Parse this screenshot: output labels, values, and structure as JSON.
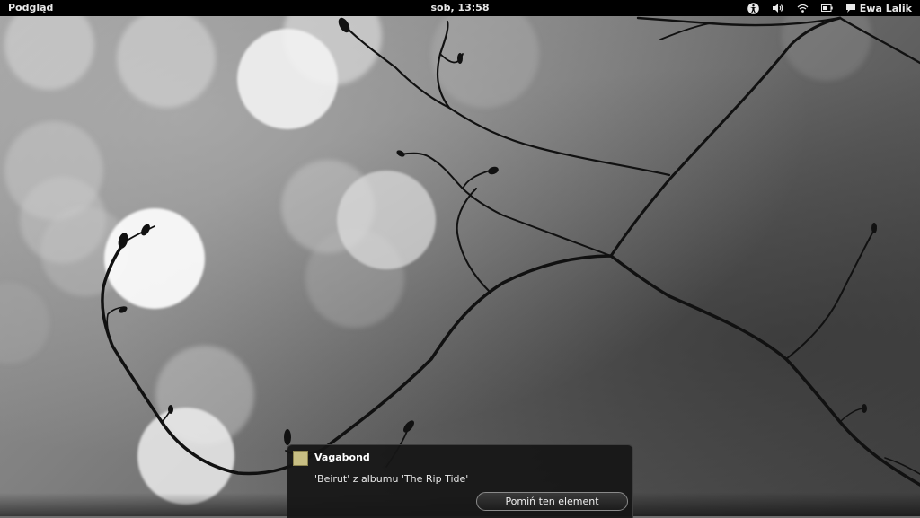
{
  "top_bar": {
    "activities_label": "Podgląd",
    "clock": "sob, 13:58",
    "tray_icons": [
      "accessibility-icon",
      "volume-icon",
      "wifi-icon",
      "battery-icon"
    ],
    "user_icon": "chat-bubble-icon",
    "user_name": "Ewa Lalik"
  },
  "notification": {
    "icon": "album-cover-icon",
    "title": "Vagabond",
    "body": "'Beirut' z albumu 'The Rip Tide'",
    "action_label": "Pomiń ten element"
  },
  "colors": {
    "top_bar_bg": "#000000",
    "notification_bg": "#161616",
    "album_icon": "#c8bf84"
  }
}
